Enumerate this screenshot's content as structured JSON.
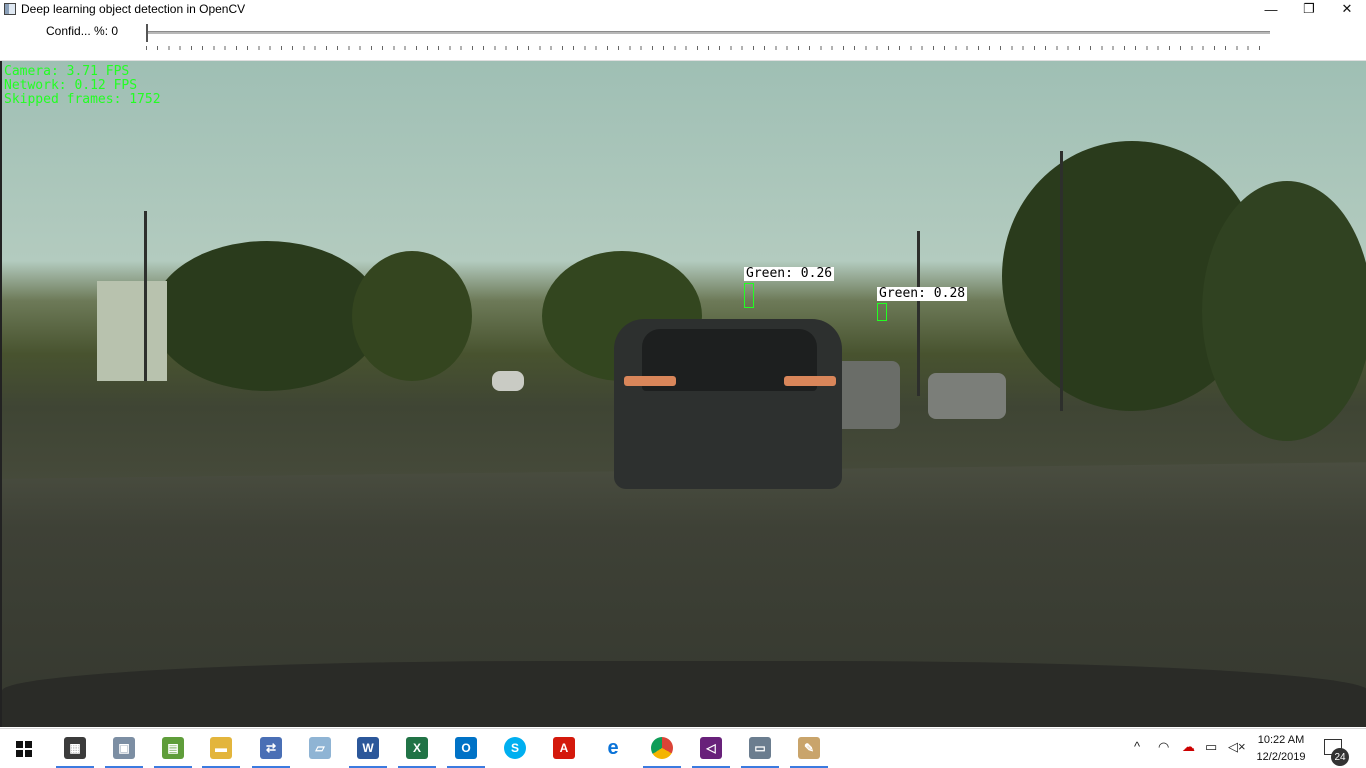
{
  "window": {
    "title": "Deep learning object detection in OpenCV",
    "minimize_icon": "minimize-icon",
    "maximize_icon": "restore-icon",
    "close_icon": "close-icon"
  },
  "trackbar": {
    "label": "Confid... %: 0",
    "value": 0
  },
  "hud": {
    "camera": "Camera: 3.71 FPS",
    "network": "Network: 0.12 FPS",
    "skipped": "Skipped frames: 1752"
  },
  "detections": [
    {
      "label": "Green: 0.26"
    },
    {
      "label": "Green: 0.28"
    }
  ],
  "taskbar": {
    "apps": [
      "calculator",
      "image-viewer",
      "project",
      "file-explorer",
      "network-tool",
      "notes",
      "word",
      "excel",
      "outlook",
      "skype",
      "acrobat",
      "edge",
      "chrome",
      "visual-studio",
      "opencv-window",
      "paint"
    ],
    "clock_time": "10:22 AM",
    "clock_date": "12/2/2019",
    "notification_count": "24"
  }
}
